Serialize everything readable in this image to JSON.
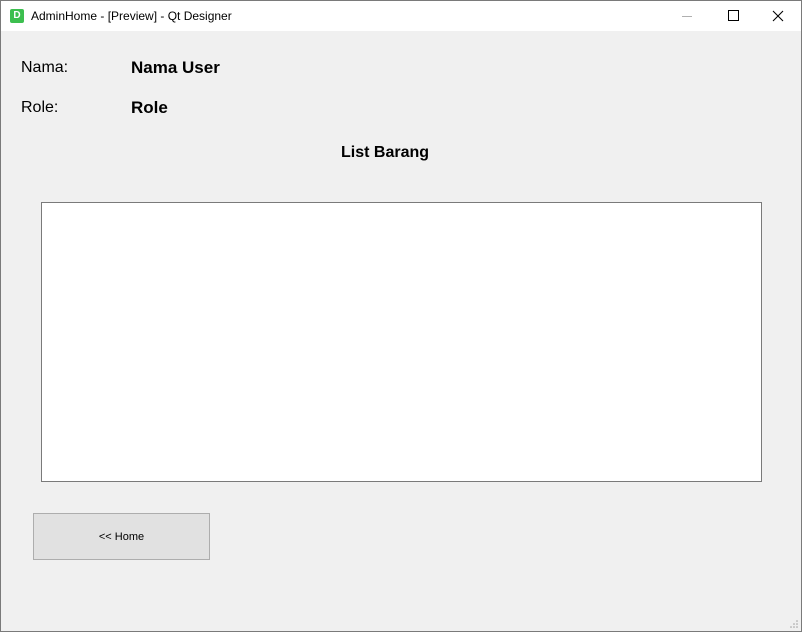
{
  "window": {
    "icon_letter": "D",
    "title": "AdminHome - [Preview] - Qt Designer"
  },
  "form": {
    "nama_label": "Nama:",
    "nama_value": "Nama User",
    "role_label": "Role:",
    "role_value": "Role",
    "list_title": "List Barang",
    "list_items": [],
    "home_button": "<< Home"
  },
  "colors": {
    "window_bg": "#f0f0f0",
    "titlebar_bg": "#ffffff",
    "app_icon": "#3cbf4f",
    "button_bg": "#e1e1e1"
  }
}
